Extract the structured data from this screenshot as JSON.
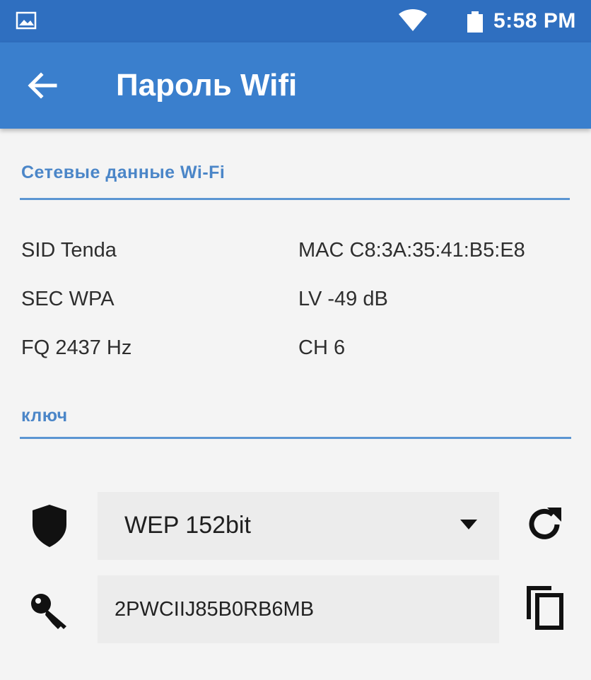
{
  "status_bar": {
    "time": "5:58 PM",
    "icons": [
      "screenshot-icon",
      "wifi-icon",
      "battery-icon"
    ]
  },
  "app_bar": {
    "title": "Пароль Wifi",
    "back_icon": "arrow-left-icon"
  },
  "network_section": {
    "title": "Сетевые данные Wi-Fi",
    "items": [
      {
        "label": "SID Tenda"
      },
      {
        "label": "MAC C8:3A:35:41:B5:E8"
      },
      {
        "label": "SEC WPA"
      },
      {
        "label": "LV -49 dB"
      },
      {
        "label": "FQ 2437 Hz"
      },
      {
        "label": "CH 6"
      }
    ]
  },
  "key_section": {
    "title": "ключ",
    "encryption": {
      "selected": "WEP 152bit"
    },
    "key_value": "2PWCIIJ85B0RB6MB",
    "icons": [
      "shield-icon",
      "refresh-icon",
      "key-icon",
      "copy-icon"
    ]
  },
  "colors": {
    "status_bar": "#2f6fc0",
    "app_bar": "#3a7fcd",
    "accent": "#4b86c8",
    "background": "#f4f4f4"
  }
}
